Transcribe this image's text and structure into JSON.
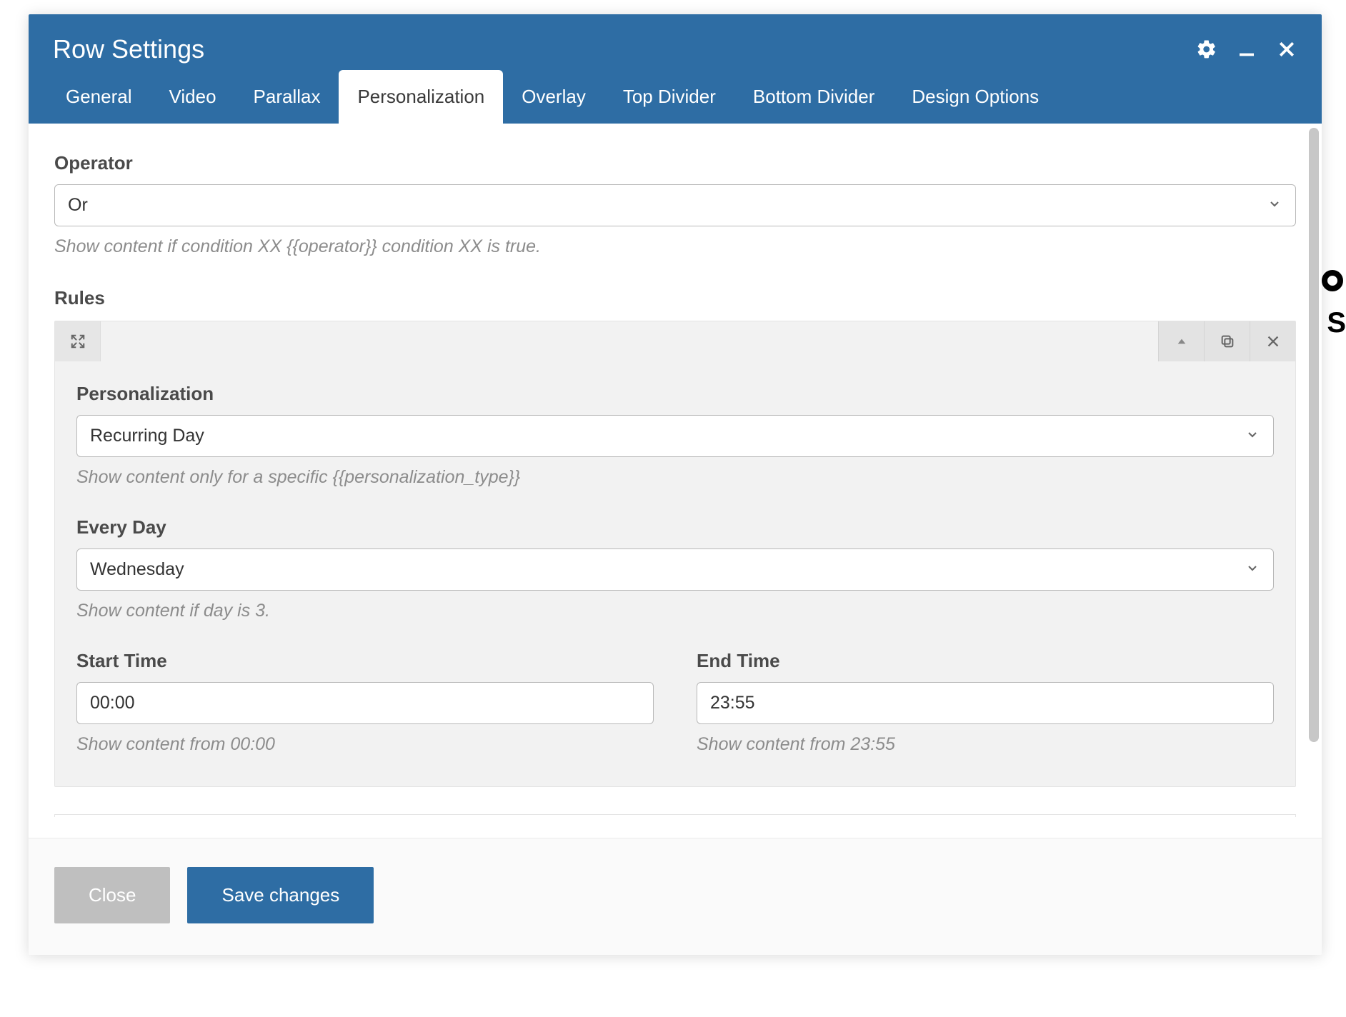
{
  "header": {
    "title": "Row Settings"
  },
  "tabs": [
    {
      "id": "general",
      "label": "General",
      "active": false
    },
    {
      "id": "video",
      "label": "Video",
      "active": false
    },
    {
      "id": "parallax",
      "label": "Parallax",
      "active": false
    },
    {
      "id": "personalization",
      "label": "Personalization",
      "active": true
    },
    {
      "id": "overlay",
      "label": "Overlay",
      "active": false
    },
    {
      "id": "topdivider",
      "label": "Top Divider",
      "active": false
    },
    {
      "id": "bottomdivider",
      "label": "Bottom Divider",
      "active": false
    },
    {
      "id": "designoptions",
      "label": "Design Options",
      "active": false
    }
  ],
  "operator": {
    "label": "Operator",
    "value": "Or",
    "helper": "Show content if condition XX {{operator}} condition XX is true."
  },
  "rules": {
    "label": "Rules",
    "items": [
      {
        "personalization": {
          "label": "Personalization",
          "value": "Recurring Day",
          "helper": "Show content only for a specific {{personalization_type}}"
        },
        "everyDay": {
          "label": "Every Day",
          "value": "Wednesday",
          "helper": "Show content if day is 3."
        },
        "startTime": {
          "label": "Start Time",
          "value": "00:00",
          "helper": "Show content from 00:00"
        },
        "endTime": {
          "label": "End Time",
          "value": "23:55",
          "helper": "Show content from 23:55"
        }
      }
    ]
  },
  "footer": {
    "close": "Close",
    "save": "Save changes"
  },
  "peripheral": {
    "rightText": "S"
  }
}
